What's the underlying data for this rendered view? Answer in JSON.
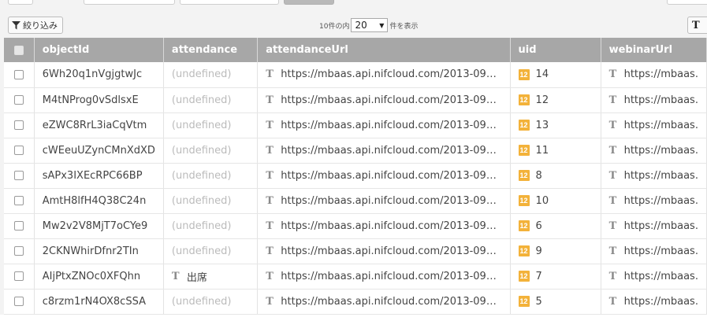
{
  "toolbar": {
    "filter_label": "絞り込み",
    "per_page_prefix": "10件の内",
    "per_page_value": "20",
    "per_page_suffix": "件を表示",
    "type_icon": "text-type-icon"
  },
  "columns": [
    "objectId",
    "attendance",
    "attendanceUrl",
    "uid",
    "webinarUrl"
  ],
  "rows": [
    {
      "objectId": "6Wh20q1nVgjgtwJc",
      "attendance": "(undefined)",
      "attendanceUrl": "https://mbaas.api.nifcloud.com/2013-09…",
      "uid": "14",
      "webinarUrl": "https://mbaas."
    },
    {
      "objectId": "M4tNProg0vSdlsxE",
      "attendance": "(undefined)",
      "attendanceUrl": "https://mbaas.api.nifcloud.com/2013-09…",
      "uid": "12",
      "webinarUrl": "https://mbaas."
    },
    {
      "objectId": "eZWC8RrL3iaCqVtm",
      "attendance": "(undefined)",
      "attendanceUrl": "https://mbaas.api.nifcloud.com/2013-09…",
      "uid": "13",
      "webinarUrl": "https://mbaas."
    },
    {
      "objectId": "cWEeuUZynCMnXdXD",
      "attendance": "(undefined)",
      "attendanceUrl": "https://mbaas.api.nifcloud.com/2013-09…",
      "uid": "11",
      "webinarUrl": "https://mbaas."
    },
    {
      "objectId": "sAPx3IXEcRPC66BP",
      "attendance": "(undefined)",
      "attendanceUrl": "https://mbaas.api.nifcloud.com/2013-09…",
      "uid": "8",
      "webinarUrl": "https://mbaas."
    },
    {
      "objectId": "AmtH8lfH4Q38C24n",
      "attendance": "(undefined)",
      "attendanceUrl": "https://mbaas.api.nifcloud.com/2013-09…",
      "uid": "10",
      "webinarUrl": "https://mbaas."
    },
    {
      "objectId": "Mw2v2V8MjT7oCYe9",
      "attendance": "(undefined)",
      "attendanceUrl": "https://mbaas.api.nifcloud.com/2013-09…",
      "uid": "6",
      "webinarUrl": "https://mbaas."
    },
    {
      "objectId": "2CKNWhirDfnr2TIn",
      "attendance": "(undefined)",
      "attendanceUrl": "https://mbaas.api.nifcloud.com/2013-09…",
      "uid": "9",
      "webinarUrl": "https://mbaas."
    },
    {
      "objectId": "AIjPtxZNOc0XFQhn",
      "attendance": "出席",
      "attendanceUrl": "https://mbaas.api.nifcloud.com/2013-09…",
      "uid": "7",
      "webinarUrl": "https://mbaas."
    },
    {
      "objectId": "c8rzm1rN4OX8cSSA",
      "attendance": "(undefined)",
      "attendanceUrl": "https://mbaas.api.nifcloud.com/2013-09…",
      "uid": "5",
      "webinarUrl": "https://mbaas."
    }
  ],
  "icons": {
    "string_type": "T",
    "number_type": "12"
  },
  "colors": {
    "header_bg": "#a7a7a7",
    "number_badge": "#f3b23a",
    "undefined_text": "#bbbbbb"
  }
}
